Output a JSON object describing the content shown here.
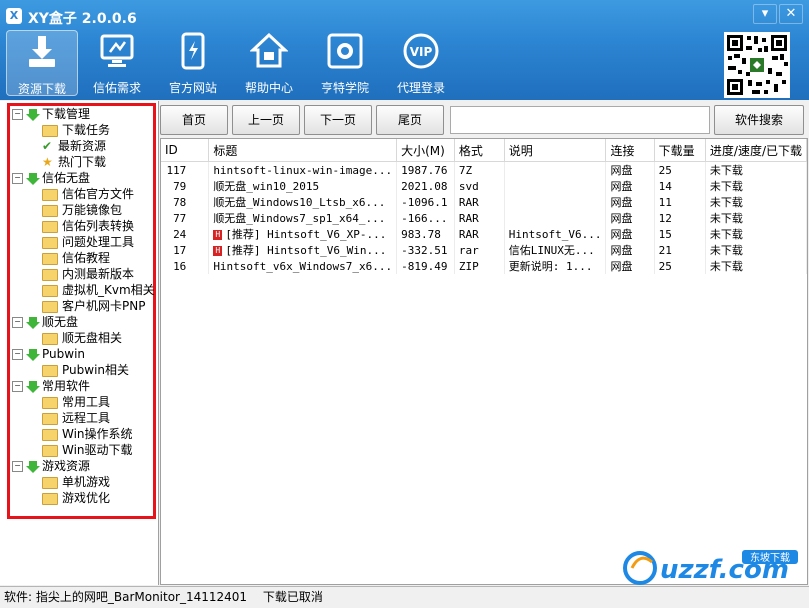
{
  "window": {
    "title": "XY盒子 2.0.0.6",
    "logo_letter": "X",
    "controls": [
      "minimize-icon",
      "close-icon"
    ]
  },
  "toolbar": [
    {
      "label": "资源下载",
      "icon": "download-icon",
      "active": true
    },
    {
      "label": "信佑需求",
      "icon": "monitor-icon",
      "active": false
    },
    {
      "label": "官方网站",
      "icon": "tablet-icon",
      "active": false
    },
    {
      "label": "帮助中心",
      "icon": "home-icon",
      "active": false
    },
    {
      "label": "亨特学院",
      "icon": "tiles-icon",
      "active": false
    },
    {
      "label": "代理登录",
      "icon": "vip-icon",
      "active": false
    }
  ],
  "tree": [
    {
      "label": "下载管理",
      "children": [
        {
          "label": "下载任务",
          "icon": "folder-icon"
        },
        {
          "label": "最新资源",
          "icon": "check-icon"
        },
        {
          "label": "热门下载",
          "icon": "star-icon"
        }
      ]
    },
    {
      "label": "信佑无盘",
      "children": [
        {
          "label": "信佑官方文件",
          "icon": "folder-icon"
        },
        {
          "label": "万能镜像包",
          "icon": "folder-icon"
        },
        {
          "label": "信佑列表转换",
          "icon": "folder-icon"
        },
        {
          "label": "问题处理工具",
          "icon": "folder-icon"
        },
        {
          "label": "信佑教程",
          "icon": "folder-icon"
        },
        {
          "label": "内测最新版本",
          "icon": "folder-icon"
        },
        {
          "label": "虚拟机_Kvm相关",
          "icon": "folder-icon"
        },
        {
          "label": "客户机网卡PNP",
          "icon": "folder-icon"
        }
      ]
    },
    {
      "label": "顺无盘",
      "children": [
        {
          "label": "顺无盘相关",
          "icon": "folder-icon"
        }
      ]
    },
    {
      "label": "Pubwin",
      "children": [
        {
          "label": "Pubwin相关",
          "icon": "folder-icon"
        }
      ]
    },
    {
      "label": "常用软件",
      "children": [
        {
          "label": "常用工具",
          "icon": "folder-icon"
        },
        {
          "label": "远程工具",
          "icon": "folder-icon"
        },
        {
          "label": "Win操作系统",
          "icon": "folder-icon"
        },
        {
          "label": "Win驱动下载",
          "icon": "folder-icon"
        }
      ]
    },
    {
      "label": "游戏资源",
      "children": [
        {
          "label": "单机游戏",
          "icon": "folder-icon"
        },
        {
          "label": "游戏优化",
          "icon": "folder-icon"
        }
      ]
    }
  ],
  "nav": {
    "first": "首页",
    "prev": "上一页",
    "next": "下一页",
    "last": "尾页",
    "search_value": "",
    "search_button": "软件搜索"
  },
  "table": {
    "columns": [
      "ID",
      "标题",
      "大小(M)",
      "格式",
      "说明",
      "连接",
      "下载量",
      "进度/速度/已下载"
    ],
    "rows": [
      {
        "id": "117",
        "hot": false,
        "title": "hintsoft-linux-win-image...",
        "size": "1987.76",
        "format": "7Z",
        "desc": "",
        "link": "网盘",
        "downloads": "25",
        "progress": "未下载"
      },
      {
        "id": "79",
        "hot": false,
        "title": "顺无盘_win10_2015",
        "size": "2021.08",
        "format": "svd",
        "desc": "",
        "link": "网盘",
        "downloads": "14",
        "progress": "未下载"
      },
      {
        "id": "78",
        "hot": false,
        "title": "顺无盘_Windows10_Ltsb_x6...",
        "size": "-1096.1",
        "format": "RAR",
        "desc": "",
        "link": "网盘",
        "downloads": "11",
        "progress": "未下载"
      },
      {
        "id": "77",
        "hot": false,
        "title": "顺无盘_Windows7_sp1_x64_...",
        "size": "-166...",
        "format": "RAR",
        "desc": "",
        "link": "网盘",
        "downloads": "12",
        "progress": "未下载"
      },
      {
        "id": "24",
        "hot": true,
        "title": "[推荐] Hintsoft_V6_XP-...",
        "size": "983.78",
        "format": "RAR",
        "desc": "Hintsoft_V6...",
        "link": "网盘",
        "downloads": "15",
        "progress": "未下载"
      },
      {
        "id": "17",
        "hot": true,
        "title": "[推荐] Hintsoft_V6_Win...",
        "size": "-332.51",
        "format": "rar",
        "desc": "信佑LINUX无...",
        "link": "网盘",
        "downloads": "21",
        "progress": "未下载"
      },
      {
        "id": "16",
        "hot": false,
        "title": "Hintsoft_v6x_Windows7_x6...",
        "size": "-819.49",
        "format": "ZIP",
        "desc": "更新说明: 1...",
        "link": "网盘",
        "downloads": "25",
        "progress": "未下载"
      }
    ]
  },
  "status": {
    "text": "软件: 指尖上的网吧_BarMonitor_14112401",
    "state": "下载已取消"
  },
  "watermark": {
    "text": "uzzf.com",
    "badge": "东坡下载"
  },
  "colors": {
    "header": "#2d86d3",
    "highlight_frame": "#e8121b",
    "watermark": "#1e88e5"
  }
}
